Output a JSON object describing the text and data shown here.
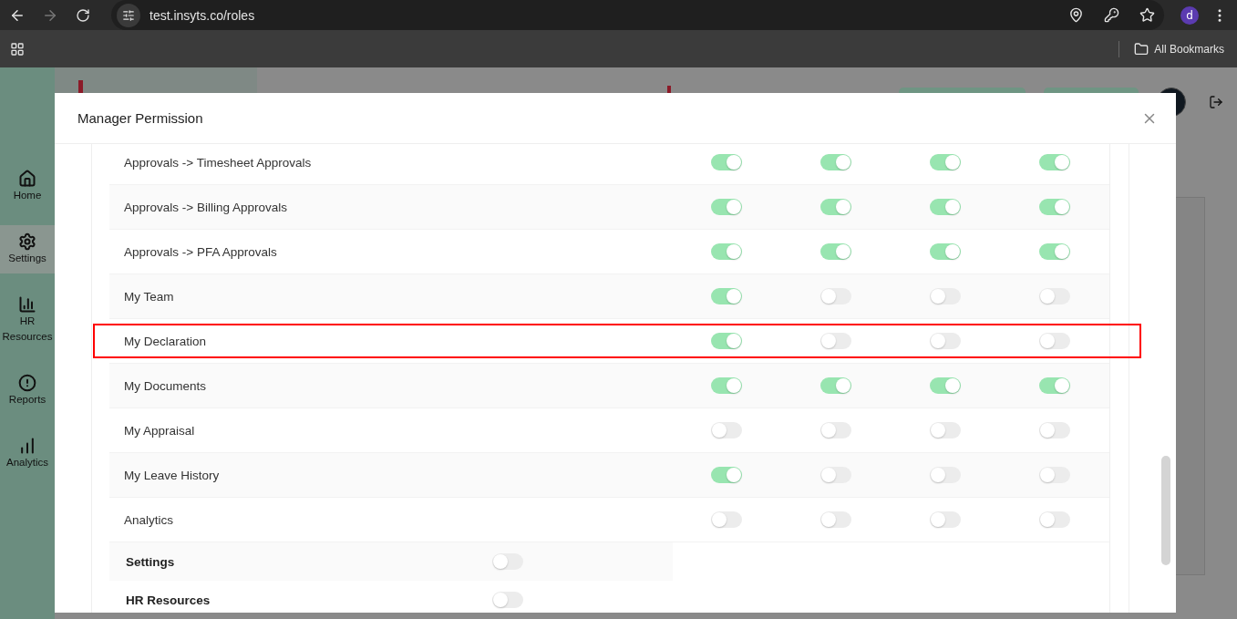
{
  "browser": {
    "url": "test.insyts.co/roles",
    "profile_initial": "d",
    "bookmarks_label": "All Bookmarks"
  },
  "app": {
    "sidebar": [
      {
        "label": "Home",
        "kind": "home",
        "selected": false
      },
      {
        "label": "Settings",
        "kind": "settings",
        "selected": true
      },
      {
        "label": "HR Resources",
        "kind": "hr",
        "selected": false
      },
      {
        "label": "Reports",
        "kind": "reports",
        "selected": false
      },
      {
        "label": "Analytics",
        "kind": "analytics",
        "selected": false
      }
    ]
  },
  "modal": {
    "title": "Manager Permission",
    "rows": [
      {
        "label": "Approvals -> Timesheet Approvals",
        "highlighted": false,
        "permissions": [
          true,
          true,
          true,
          true
        ]
      },
      {
        "label": "Approvals -> Billing Approvals",
        "highlighted": false,
        "permissions": [
          true,
          true,
          true,
          true
        ]
      },
      {
        "label": "Approvals -> PFA Approvals",
        "highlighted": false,
        "permissions": [
          true,
          true,
          true,
          true
        ]
      },
      {
        "label": "My Team",
        "highlighted": false,
        "permissions": [
          true,
          false,
          false,
          false
        ]
      },
      {
        "label": "My Declaration",
        "highlighted": true,
        "permissions": [
          true,
          false,
          false,
          false
        ]
      },
      {
        "label": "My Documents",
        "highlighted": false,
        "permissions": [
          true,
          true,
          true,
          true
        ]
      },
      {
        "label": "My Appraisal",
        "highlighted": false,
        "permissions": [
          false,
          false,
          false,
          false
        ]
      },
      {
        "label": "My Leave History",
        "highlighted": false,
        "permissions": [
          true,
          false,
          false,
          false
        ]
      },
      {
        "label": "Analytics",
        "highlighted": false,
        "permissions": [
          false,
          false,
          false,
          false
        ]
      }
    ],
    "sections": [
      {
        "label": "Settings",
        "on": false
      },
      {
        "label": "HR Resources",
        "on": false
      }
    ]
  }
}
